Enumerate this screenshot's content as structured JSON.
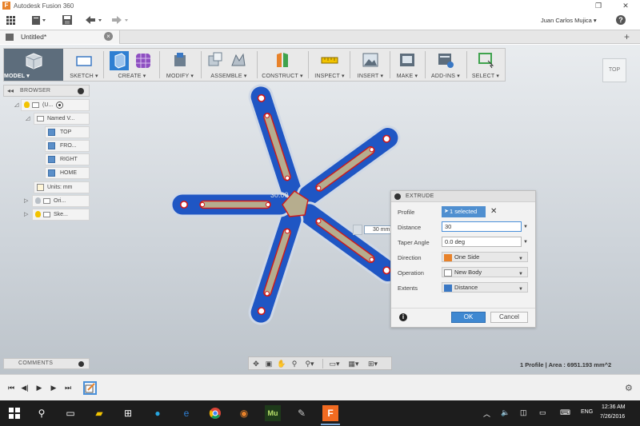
{
  "window": {
    "title": "Autodesk Fusion 360",
    "logo_letter": "F",
    "controls": {
      "restore": "❐",
      "close": "✕"
    }
  },
  "quick_access": {
    "user_name": "Juan Carlos Mujica ▾",
    "help": "?",
    "icons": [
      "grid-icon",
      "file-icon",
      "save-icon",
      "undo-icon",
      "redo-icon"
    ]
  },
  "document_tab": {
    "label": "Untitled*",
    "close": "×",
    "add": "+"
  },
  "toolbar": {
    "groups": [
      {
        "key": "model",
        "label": "MODEL ▾"
      },
      {
        "key": "sketch",
        "label": "SKETCH ▾"
      },
      {
        "key": "create",
        "label": "CREATE ▾"
      },
      {
        "key": "modify",
        "label": "MODIFY ▾"
      },
      {
        "key": "assemble",
        "label": "ASSEMBLE ▾"
      },
      {
        "key": "construct",
        "label": "CONSTRUCT ▾"
      },
      {
        "key": "inspect",
        "label": "INSPECT ▾"
      },
      {
        "key": "insert",
        "label": "INSERT ▾"
      },
      {
        "key": "make",
        "label": "MAKE ▾"
      },
      {
        "key": "addins",
        "label": "ADD-INS ▾"
      },
      {
        "key": "select",
        "label": "SELECT ▾"
      }
    ]
  },
  "viewcube": {
    "label": "TOP"
  },
  "browser": {
    "title": "BROWSER",
    "nodes": [
      {
        "label": "(U..."
      },
      {
        "label": "Named V..."
      },
      {
        "label": "TOP"
      },
      {
        "label": "FRO..."
      },
      {
        "label": "RIGHT"
      },
      {
        "label": "HOME"
      },
      {
        "label": "Units: mm"
      },
      {
        "label": "Ori..."
      },
      {
        "label": "Ske..."
      }
    ]
  },
  "canvas": {
    "dimension_input": "30 mm",
    "dimension_label": "30.00"
  },
  "extrude_dialog": {
    "title": "EXTRUDE",
    "rows": {
      "profile": {
        "label": "Profile",
        "value": "1 selected"
      },
      "distance": {
        "label": "Distance",
        "value": "30"
      },
      "taper": {
        "label": "Taper Angle",
        "value": "0.0 deg"
      },
      "direction": {
        "label": "Direction",
        "value": "One Side"
      },
      "operation": {
        "label": "Operation",
        "value": "New Body"
      },
      "extents": {
        "label": "Extents",
        "value": "Distance"
      }
    },
    "ok_label": "OK",
    "cancel_label": "Cancel"
  },
  "comments": {
    "title": "COMMENTS"
  },
  "status": {
    "text": "1 Profile | Area : 6951.193 mm^2"
  },
  "taskbar": {
    "language": "ENG",
    "time": "12:36 AM",
    "date": "7/26/2016",
    "apps": [
      "windows-start-icon",
      "search-icon",
      "task-view-icon",
      "file-explorer-icon",
      "store-icon",
      "skype-icon",
      "edge-icon",
      "chrome-icon",
      "firefox-icon",
      "muse-icon",
      "paint-icon",
      "fusion-icon"
    ],
    "muse_label": "Mu"
  },
  "colors": {
    "model_blue": "#1f56c4",
    "slot_fill": "#b6ad8e",
    "highlight_red": "#d01818",
    "accent_blue": "#3f88d1"
  }
}
